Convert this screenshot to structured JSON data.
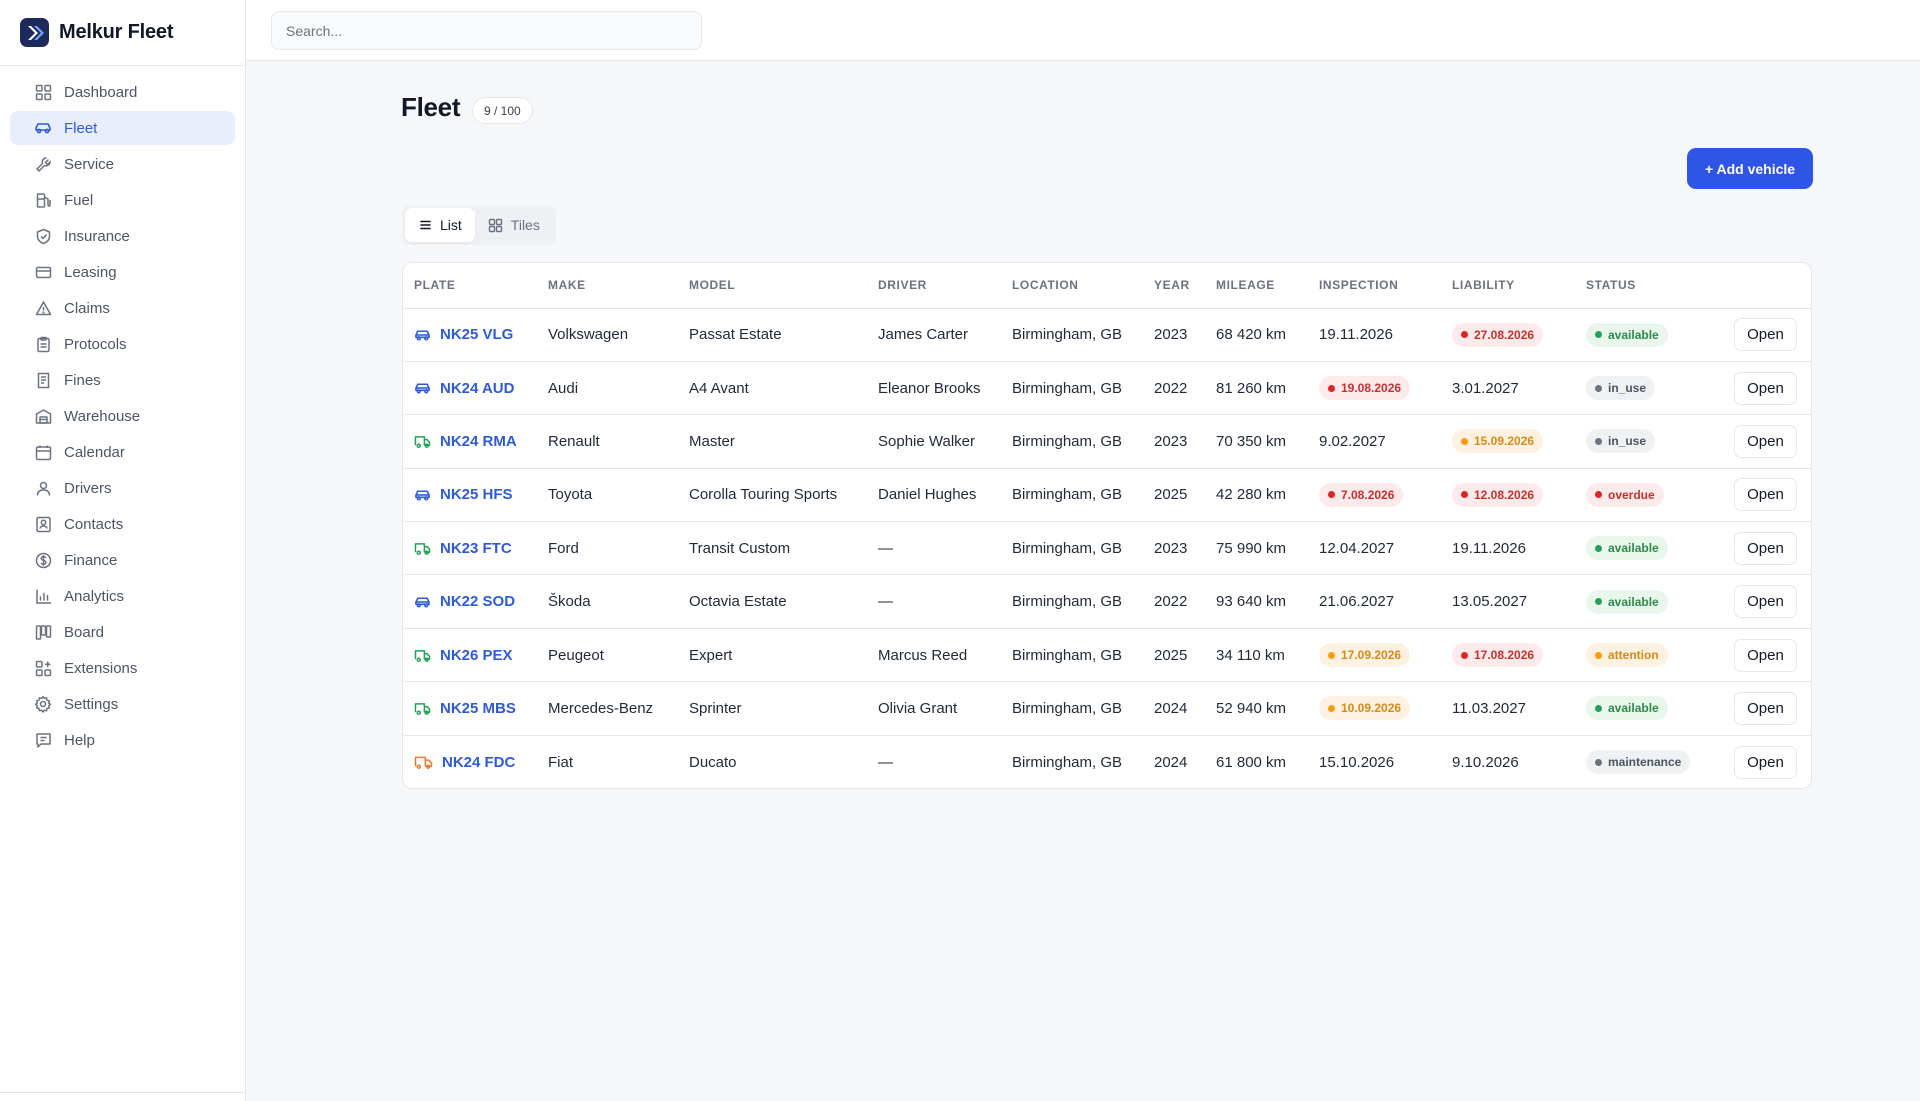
{
  "brand": {
    "name": "Melkur Fleet"
  },
  "sidebar": {
    "items": [
      {
        "label": "Dashboard",
        "icon": "dashboard-icon"
      },
      {
        "label": "Fleet",
        "icon": "car-icon",
        "active": true
      },
      {
        "label": "Service",
        "icon": "wrench-icon"
      },
      {
        "label": "Fuel",
        "icon": "fuel-icon"
      },
      {
        "label": "Insurance",
        "icon": "shield-icon"
      },
      {
        "label": "Leasing",
        "icon": "card-icon"
      },
      {
        "label": "Claims",
        "icon": "warning-icon"
      },
      {
        "label": "Protocols",
        "icon": "clipboard-icon"
      },
      {
        "label": "Fines",
        "icon": "receipt-icon"
      },
      {
        "label": "Warehouse",
        "icon": "warehouse-icon"
      },
      {
        "label": "Calendar",
        "icon": "calendar-icon"
      },
      {
        "label": "Drivers",
        "icon": "user-icon"
      },
      {
        "label": "Contacts",
        "icon": "contact-icon"
      },
      {
        "label": "Finance",
        "icon": "dollar-icon"
      },
      {
        "label": "Analytics",
        "icon": "chart-icon"
      },
      {
        "label": "Board",
        "icon": "board-icon"
      },
      {
        "label": "Extensions",
        "icon": "extensions-icon"
      },
      {
        "label": "Settings",
        "icon": "gear-icon"
      },
      {
        "label": "Help",
        "icon": "help-icon"
      }
    ]
  },
  "search": {
    "placeholder": "Search..."
  },
  "page": {
    "title": "Fleet",
    "count": "9 / 100",
    "add_label": "+ Add vehicle"
  },
  "view_toggle": {
    "list_label": "List",
    "tiles_label": "Tiles",
    "active": "list"
  },
  "colors": {
    "accent": "#2f55e6",
    "link": "#2f5bd3",
    "danger": "#dc2626",
    "warning": "#f59e0b",
    "success": "#22a05a",
    "neutral": "#6b7280",
    "van_icon_green": "#22a05a",
    "truck_icon_orange": "#e8792c"
  },
  "table": {
    "headers": [
      "PLATE",
      "MAKE",
      "MODEL",
      "DRIVER",
      "LOCATION",
      "YEAR",
      "MILEAGE",
      "INSPECTION",
      "LIABILITY",
      "STATUS",
      ""
    ],
    "open_label": "Open",
    "rows": [
      {
        "vehicle_icon": "car",
        "plate": "NK25 VLG",
        "make": "Volkswagen",
        "model": "Passat Estate",
        "driver": "James Carter",
        "location": "Birmingham, GB",
        "year": "2023",
        "mileage": "68 420 km",
        "inspection": {
          "value": "19.11.2026",
          "flag": null
        },
        "liability": {
          "value": "27.08.2026",
          "flag": "red"
        },
        "status": {
          "value": "available",
          "flag": "green"
        }
      },
      {
        "vehicle_icon": "car",
        "plate": "NK24 AUD",
        "make": "Audi",
        "model": "A4 Avant",
        "driver": "Eleanor Brooks",
        "location": "Birmingham, GB",
        "year": "2022",
        "mileage": "81 260 km",
        "inspection": {
          "value": "19.08.2026",
          "flag": "red"
        },
        "liability": {
          "value": "3.01.2027",
          "flag": null
        },
        "status": {
          "value": "in_use",
          "flag": "gray"
        }
      },
      {
        "vehicle_icon": "van",
        "plate": "NK24 RMA",
        "make": "Renault",
        "model": "Master",
        "driver": "Sophie Walker",
        "location": "Birmingham, GB",
        "year": "2023",
        "mileage": "70 350 km",
        "inspection": {
          "value": "9.02.2027",
          "flag": null
        },
        "liability": {
          "value": "15.09.2026",
          "flag": "amber"
        },
        "status": {
          "value": "in_use",
          "flag": "gray"
        }
      },
      {
        "vehicle_icon": "car",
        "plate": "NK25 HFS",
        "make": "Toyota",
        "model": "Corolla Touring Sports",
        "driver": "Daniel Hughes",
        "location": "Birmingham, GB",
        "year": "2025",
        "mileage": "42 280 km",
        "inspection": {
          "value": "7.08.2026",
          "flag": "red"
        },
        "liability": {
          "value": "12.08.2026",
          "flag": "red"
        },
        "status": {
          "value": "overdue",
          "flag": "red"
        }
      },
      {
        "vehicle_icon": "van",
        "plate": "NK23 FTC",
        "make": "Ford",
        "model": "Transit Custom",
        "driver": "—",
        "location": "Birmingham, GB",
        "year": "2023",
        "mileage": "75 990 km",
        "inspection": {
          "value": "12.04.2027",
          "flag": null
        },
        "liability": {
          "value": "19.11.2026",
          "flag": null
        },
        "status": {
          "value": "available",
          "flag": "green"
        }
      },
      {
        "vehicle_icon": "car",
        "plate": "NK22 SOD",
        "make": "Škoda",
        "model": "Octavia Estate",
        "driver": "—",
        "location": "Birmingham, GB",
        "year": "2022",
        "mileage": "93 640 km",
        "inspection": {
          "value": "21.06.2027",
          "flag": null
        },
        "liability": {
          "value": "13.05.2027",
          "flag": null
        },
        "status": {
          "value": "available",
          "flag": "green"
        }
      },
      {
        "vehicle_icon": "van",
        "plate": "NK26 PEX",
        "make": "Peugeot",
        "model": "Expert",
        "driver": "Marcus Reed",
        "location": "Birmingham, GB",
        "year": "2025",
        "mileage": "34 110 km",
        "inspection": {
          "value": "17.09.2026",
          "flag": "amber"
        },
        "liability": {
          "value": "17.08.2026",
          "flag": "red"
        },
        "status": {
          "value": "attention",
          "flag": "amber"
        }
      },
      {
        "vehicle_icon": "van",
        "plate": "NK25 MBS",
        "make": "Mercedes-Benz",
        "model": "Sprinter",
        "driver": "Olivia Grant",
        "location": "Birmingham, GB",
        "year": "2024",
        "mileage": "52 940 km",
        "inspection": {
          "value": "10.09.2026",
          "flag": "amber"
        },
        "liability": {
          "value": "11.03.2027",
          "flag": null
        },
        "status": {
          "value": "available",
          "flag": "green"
        }
      },
      {
        "vehicle_icon": "truck",
        "plate": "NK24 FDC",
        "make": "Fiat",
        "model": "Ducato",
        "driver": "—",
        "location": "Birmingham, GB",
        "year": "2024",
        "mileage": "61 800 km",
        "inspection": {
          "value": "15.10.2026",
          "flag": null
        },
        "liability": {
          "value": "9.10.2026",
          "flag": null
        },
        "status": {
          "value": "maintenance",
          "flag": "gray"
        }
      }
    ]
  }
}
